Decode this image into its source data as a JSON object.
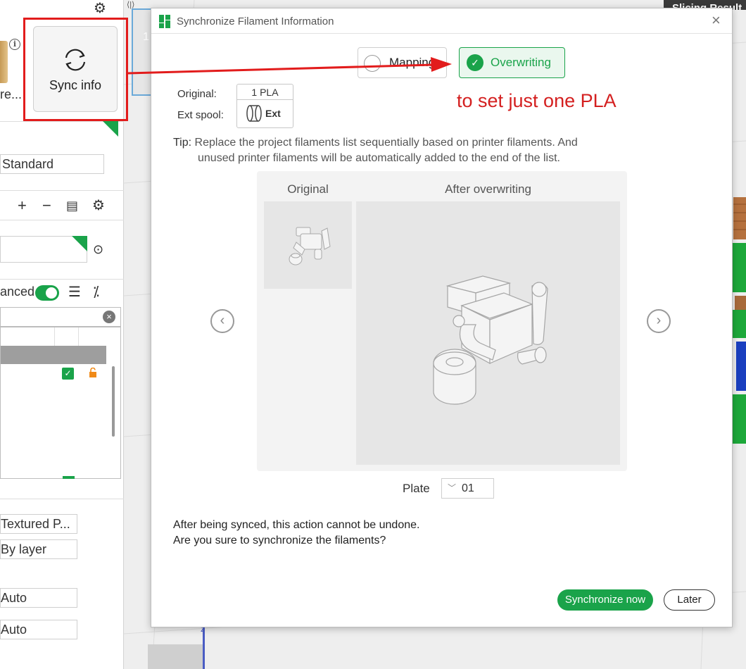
{
  "sidebar": {
    "preset_name": "re...",
    "sync_button_label": "Sync info",
    "quality_preset": "Standard",
    "advanced_label": "anced",
    "plate_type": "Textured P...",
    "wall_sequence": "By layer",
    "auto_1": "Auto",
    "auto_2": "Auto"
  },
  "scene": {
    "plate_number": "1",
    "slicing_tab_label": "Slicing Result",
    "axis_label": "z"
  },
  "dialog": {
    "title": "Synchronize Filament Information",
    "modes": {
      "mapping": "Mapping",
      "overwriting": "Overwriting",
      "selected": "overwriting"
    },
    "original_label": "Original:",
    "ext_spool_label": "Ext spool:",
    "spool_filament": "1 PLA",
    "spool_ext": "Ext",
    "annotation": "to set just one PLA",
    "tip_label": "Tip:",
    "tip_line1": "Replace the project filaments list sequentially based on printer filaments. And",
    "tip_line2": "unused printer filaments will be automatically added to the end of the list.",
    "preview": {
      "original_header": "Original",
      "after_header": "After overwriting"
    },
    "plate_label": "Plate",
    "plate_value": "01",
    "warning_line1": "After being synced, this action cannot be undone.",
    "warning_line2": "Are you sure to synchronize the filaments?",
    "sync_now_label": "Synchronize now",
    "later_label": "Later"
  },
  "colors": {
    "accent_green": "#1aa34a",
    "annotation_red": "#d42020"
  }
}
